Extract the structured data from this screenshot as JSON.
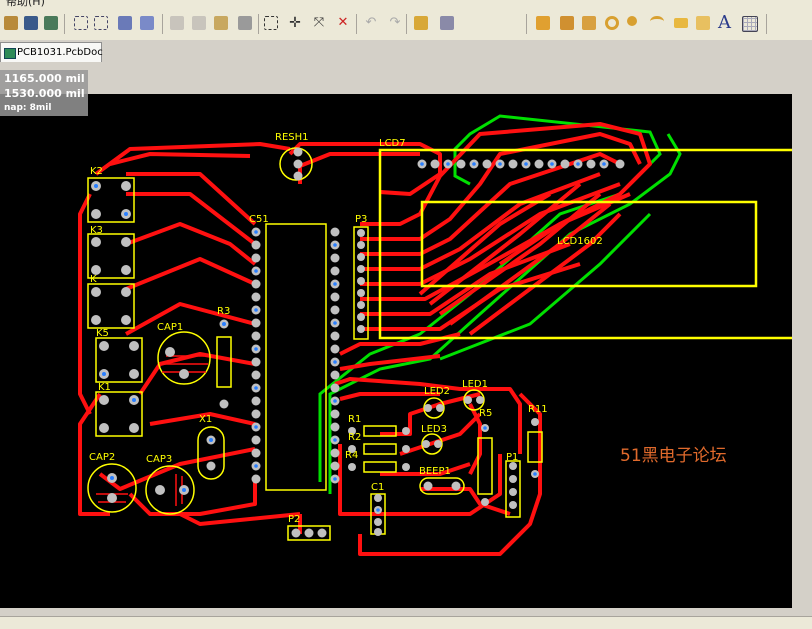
{
  "menubar": {
    "partial_label": "帮助(H)"
  },
  "toolbar": {
    "icons": [
      "open-icon",
      "layer-icon",
      "board-icon",
      "zoom-fit-icon",
      "zoom-area-icon",
      "component-icon",
      "filter-icon",
      "cut-icon",
      "copy-icon",
      "paste-icon",
      "rubber-stamp-icon",
      "select-icon",
      "move-icon",
      "cross-probe-icon",
      "deselect-icon",
      "undo-icon",
      "redo-icon",
      "highlight-icon",
      "inspector-icon",
      "route-icon",
      "interactive-route-icon",
      "differential-route-icon",
      "via-icon",
      "pad-icon",
      "arc-icon",
      "fill-icon",
      "polygon-icon",
      "text-icon",
      "grid-icon"
    ]
  },
  "document_tab": {
    "label": "PCB1031.PcbDoc"
  },
  "coordinates": {
    "x": "1165.000 mil",
    "y": "1530.000 mil",
    "snap": "nap: 8mil"
  },
  "designators": {
    "resh1": "RESH1",
    "lcd7": "LCD7",
    "lcd1602": "LCD1602",
    "k2": "K2",
    "k3": "K3",
    "k4": "K",
    "k5": "K5",
    "k1": "K1",
    "c51": "C51",
    "p3": "P3",
    "cap1": "CAP1",
    "r3": "R3",
    "x1": "X1",
    "cap2": "CAP2",
    "cap3": "CAP3",
    "led2": "LED2",
    "led1": "LED1",
    "led3": "LED3",
    "r5": "R5",
    "r11": "R11",
    "r1": "R1",
    "r2": "R2",
    "r4": "R4",
    "beep1": "BEEP1",
    "p1": "P1",
    "c1": "C1",
    "p2": "P2"
  },
  "watermark": "51黑电子论坛",
  "colors": {
    "board": "#000000",
    "top_copper": "#ff0000",
    "bottom_copper": "#00ff00",
    "silkscreen": "#ffff00",
    "pad": "#c0c0c0",
    "via_hole": "#0080ff"
  }
}
